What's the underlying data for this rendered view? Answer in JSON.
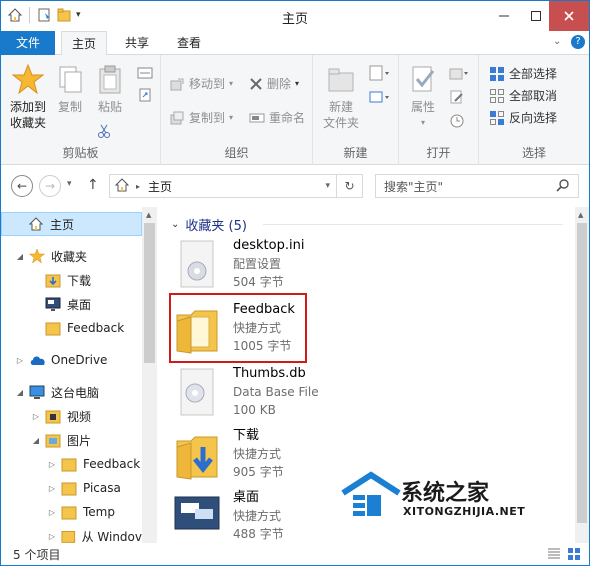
{
  "window": {
    "title": "主页"
  },
  "tabs": {
    "file": "文件",
    "home": "主页",
    "share": "共享",
    "view": "查看"
  },
  "ribbon": {
    "clipboard": {
      "label": "剪贴板",
      "pin_line1": "添加到",
      "pin_line2": "收藏夹",
      "copy": "复制",
      "paste": "粘贴"
    },
    "organize": {
      "label": "组织",
      "move_to": "移动到",
      "copy_to": "复制到",
      "delete": "删除",
      "rename": "重命名"
    },
    "new": {
      "label": "新建",
      "new_folder_line1": "新建",
      "new_folder_line2": "文件夹"
    },
    "open": {
      "label": "打开",
      "properties": "属性"
    },
    "select": {
      "label": "选择",
      "select_all": "全部选择",
      "select_none": "全部取消",
      "invert": "反向选择"
    }
  },
  "address": {
    "path": "主页",
    "search_placeholder": "搜索\"主页\""
  },
  "nav": {
    "items": [
      {
        "label": "主页"
      },
      {
        "label": "收藏夹"
      },
      {
        "label": "下载"
      },
      {
        "label": "桌面"
      },
      {
        "label": "Feedback"
      },
      {
        "label": "OneDrive"
      },
      {
        "label": "这台电脑"
      },
      {
        "label": "视频"
      },
      {
        "label": "图片"
      },
      {
        "label": "Feedback"
      },
      {
        "label": "Picasa"
      },
      {
        "label": "Temp"
      },
      {
        "label": "从 Windov"
      }
    ]
  },
  "content": {
    "section_title": "收藏夹 (5)",
    "items": [
      {
        "name": "desktop.ini",
        "type": "配置设置",
        "size": "504 字节"
      },
      {
        "name": "Feedback",
        "type": "快捷方式",
        "size": "1005 字节"
      },
      {
        "name": "Thumbs.db",
        "type": "Data Base File",
        "size": "100 KB"
      },
      {
        "name": "下载",
        "type": "快捷方式",
        "size": "905 字节"
      },
      {
        "name": "桌面",
        "type": "快捷方式",
        "size": "488 字节"
      }
    ]
  },
  "status": {
    "count": "5 个项目"
  },
  "watermark": {
    "brand": "系统之家",
    "url": "XITONGZHIJIA.NET"
  },
  "colors": {
    "accent": "#1979ca",
    "folder": "#f5c44a",
    "highlight": "#d11a1a",
    "selected": "#cce8ff"
  }
}
